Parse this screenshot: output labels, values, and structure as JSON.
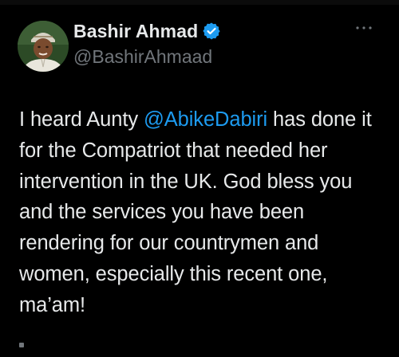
{
  "user": {
    "display_name": "Bashir Ahmad",
    "handle": "@BashirAhmaad",
    "verified": true
  },
  "icons": {
    "verified": "verified-badge-icon",
    "more": "more-options-icon"
  },
  "tweet": {
    "text_before": "I heard Aunty ",
    "mention": "@AbikeDabiri",
    "text_after": " has done it for the Compatriot that needed her intervention in the UK. God bless you and the services you have been rendering for our countrymen and women, especially this recent one, ma’am!"
  },
  "colors": {
    "background": "#000000",
    "text": "#e7e9ea",
    "secondary": "#71767b",
    "accent": "#1d9bf0"
  }
}
